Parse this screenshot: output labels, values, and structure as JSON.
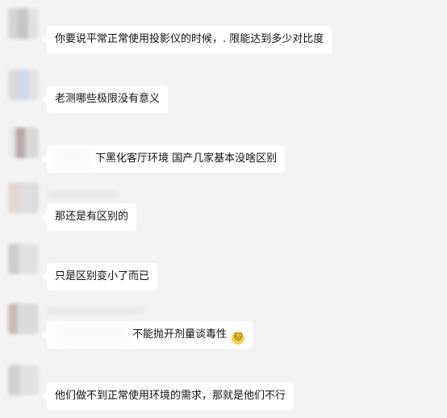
{
  "messages": [
    {
      "text": "你要说平常正常使用投影仪的时候，.  限能达到多少对比度"
    },
    {
      "text": "老测哪些极限没有意义"
    },
    {
      "text": "下黑化客厅环境 国产几家基本没啥区别"
    },
    {
      "text": "那还是有区别的"
    },
    {
      "text": "只是区别变小了而已"
    },
    {
      "text": "不能抛开剂量谈毒性"
    },
    {
      "text": "他们做不到正常使用环境的需求，那就是他们不行"
    }
  ],
  "emoji_name": "cat-face-icon",
  "emoji_glyph": "🐱",
  "colors": {
    "background": "#f3f3f3",
    "bubble": "#ffffff",
    "text": "#111111"
  }
}
